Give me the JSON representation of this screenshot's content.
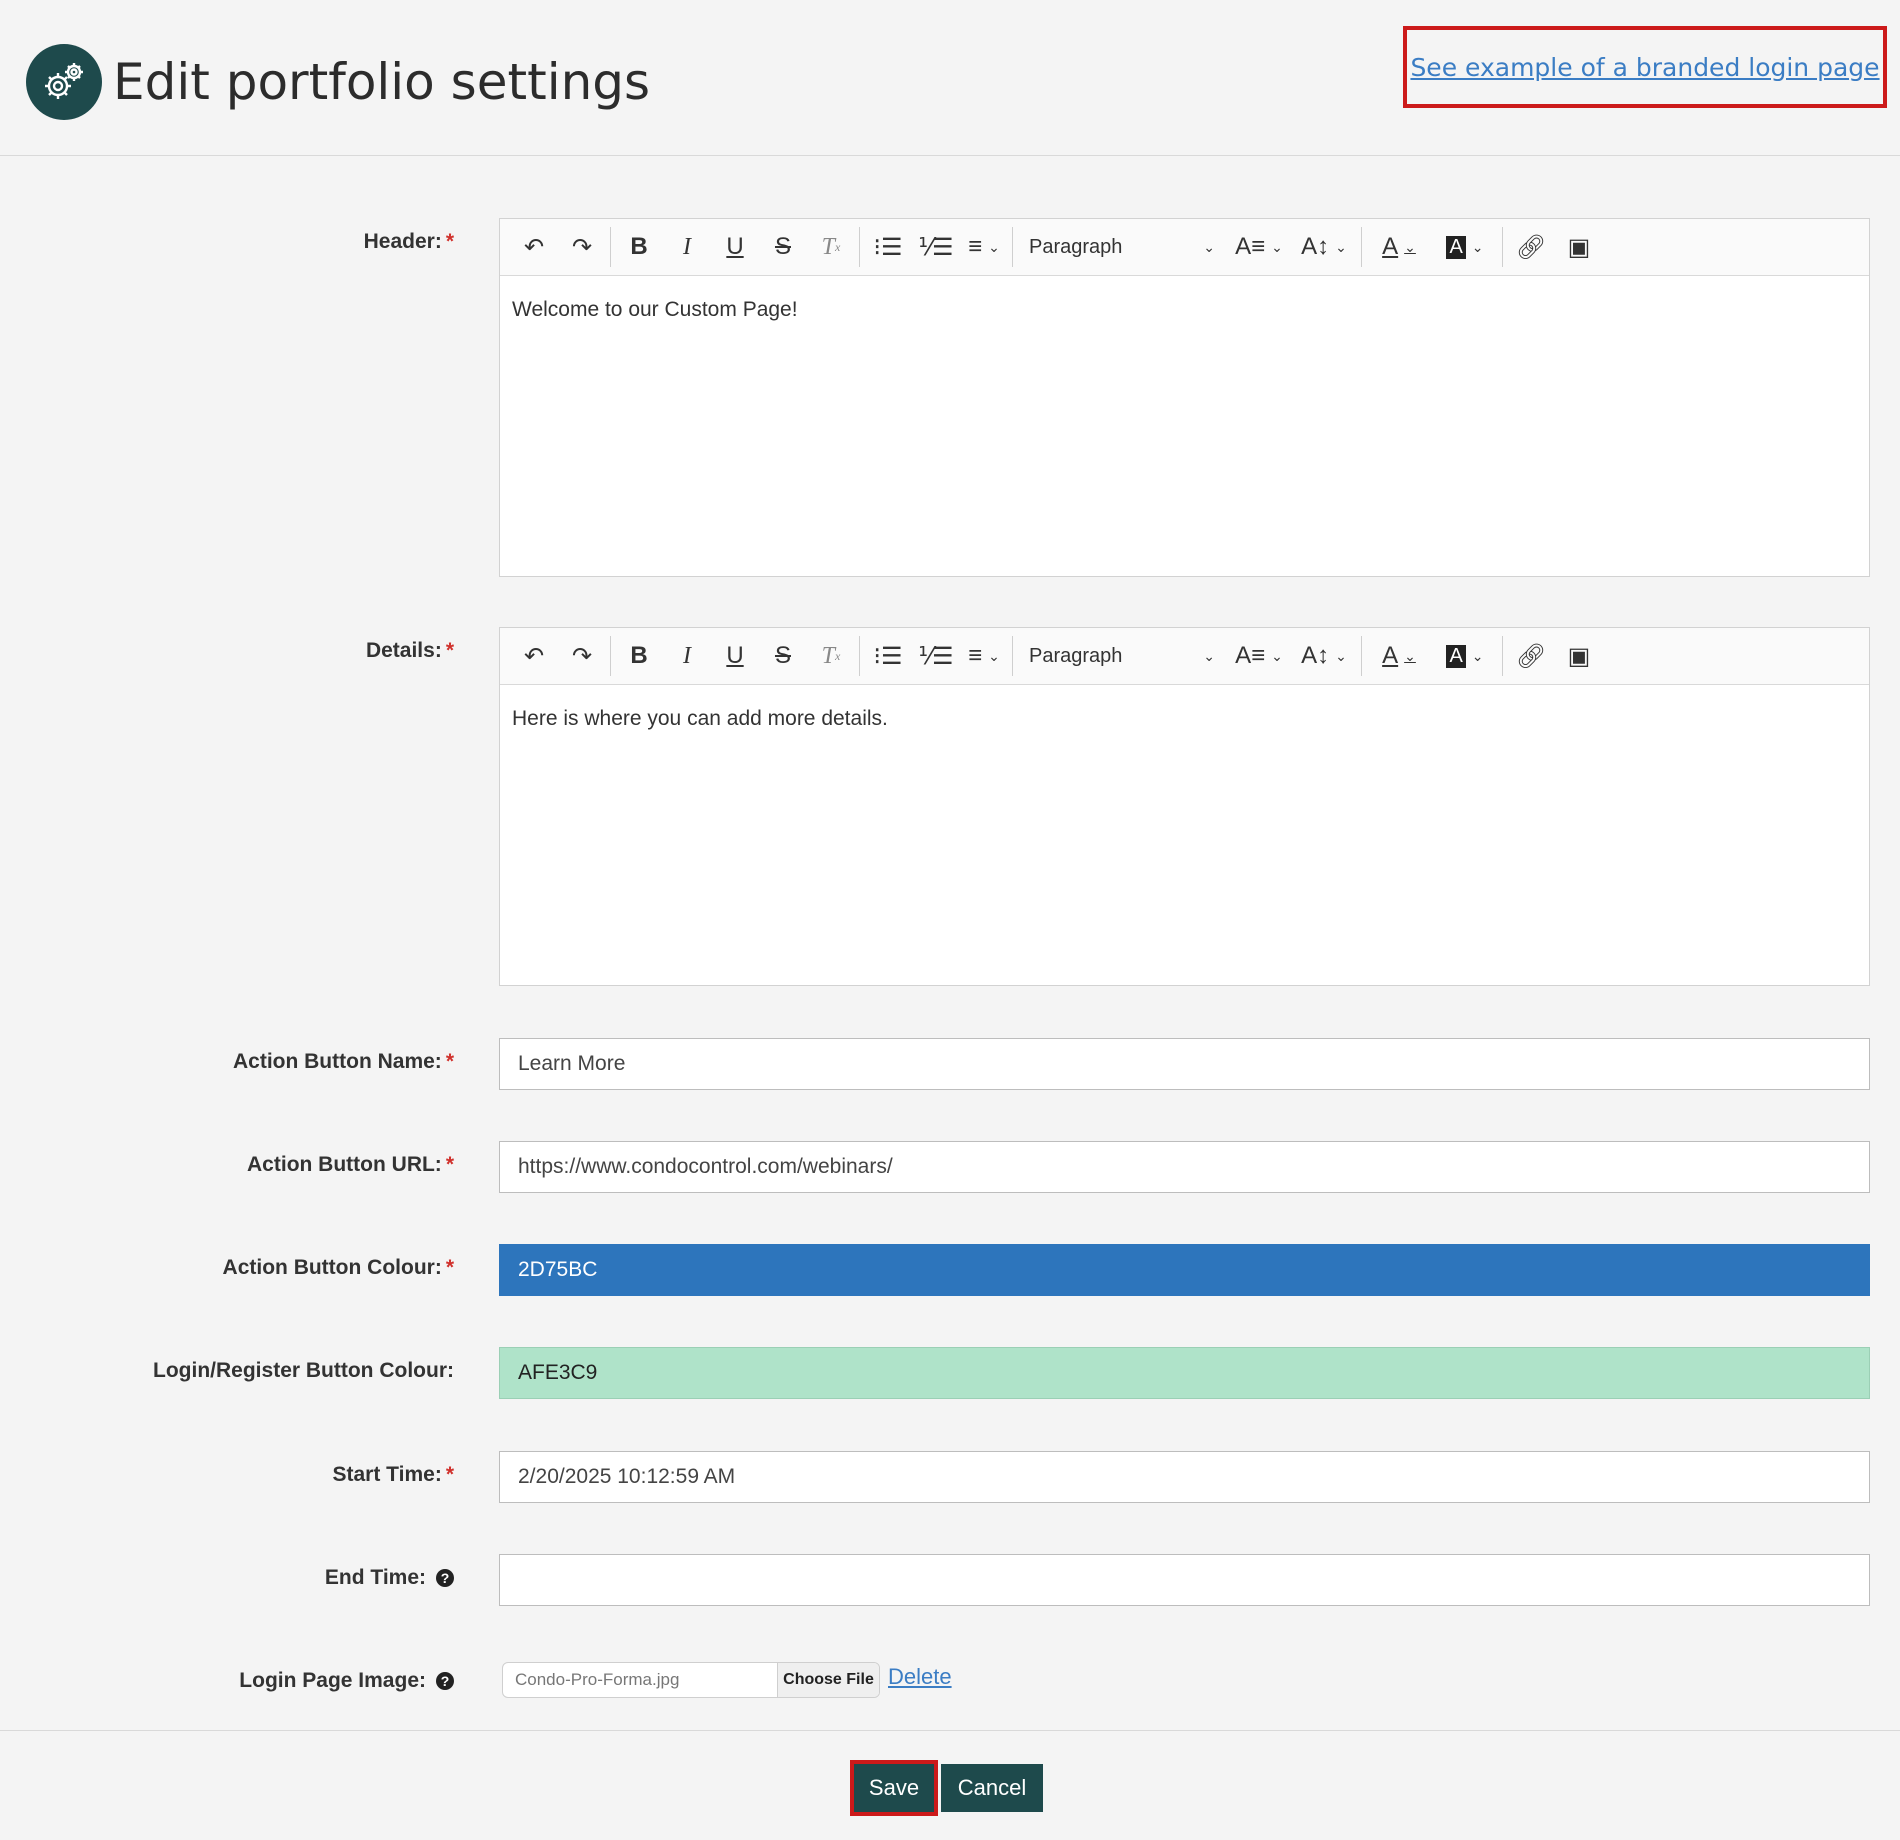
{
  "header": {
    "title": "Edit portfolio settings",
    "example_link": "See example of a branded login page"
  },
  "toolbar": {
    "paragraph_label": "Paragraph"
  },
  "fields": {
    "header": {
      "label": "Header:",
      "required": "*",
      "content": "Welcome to our Custom Page!"
    },
    "details": {
      "label": "Details:",
      "required": "*",
      "content": "Here is where you can add more details."
    },
    "action_button_name": {
      "label": "Action Button Name:",
      "required": "*",
      "value": "Learn More"
    },
    "action_button_url": {
      "label": "Action Button URL:",
      "required": "*",
      "value": "https://www.condocontrol.com/webinars/"
    },
    "action_button_colour": {
      "label": "Action Button Colour:",
      "required": "*",
      "value": "2D75BC",
      "color": "#2D75BC"
    },
    "login_register_colour": {
      "label": "Login/Register Button Colour:",
      "value": "AFE3C9",
      "color": "#AFE3C9"
    },
    "start_time": {
      "label": "Start Time:",
      "required": "*",
      "value": "2/20/2025 10:12:59 AM"
    },
    "end_time": {
      "label": "End Time:",
      "value": ""
    },
    "login_page_image": {
      "label": "Login Page Image:",
      "file_name": "Condo-Pro-Forma.jpg",
      "choose_file": "Choose File",
      "delete": "Delete"
    }
  },
  "footer": {
    "save": "Save",
    "cancel": "Cancel"
  },
  "colors": {
    "brand_dark": "#1E4A4C",
    "link": "#3B7DC4",
    "required": "#D0302B",
    "highlight_border": "#CC1A1A"
  }
}
